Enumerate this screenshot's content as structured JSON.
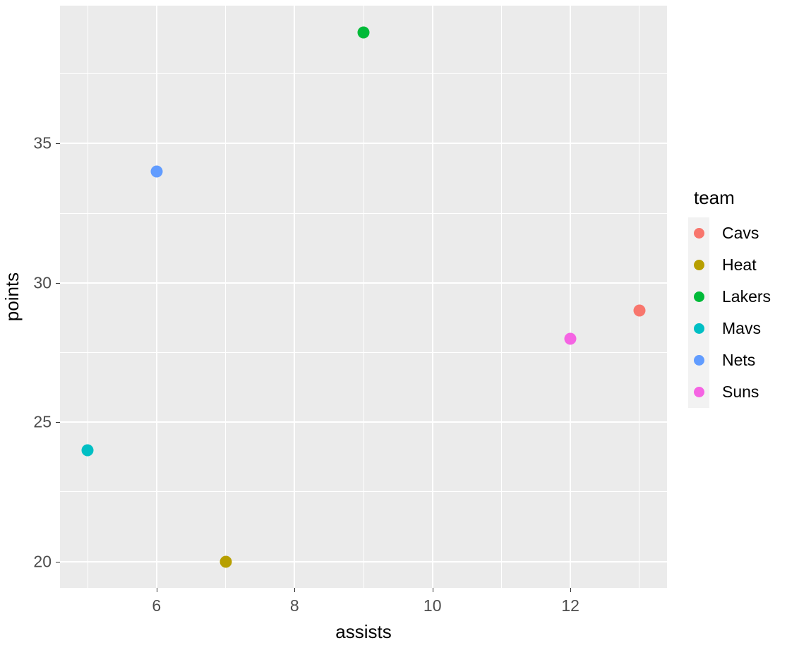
{
  "chart_data": {
    "type": "scatter",
    "title": "",
    "xlabel": "assists",
    "ylabel": "points",
    "xlim": [
      4.6,
      13.4
    ],
    "ylim": [
      19.05,
      39.95
    ],
    "x_ticks": [
      6,
      8,
      10,
      12
    ],
    "y_ticks": [
      20,
      25,
      30,
      35
    ],
    "x_minor_ticks": [
      5,
      7,
      9,
      11,
      13
    ],
    "y_minor_ticks": [
      22.5,
      27.5,
      32.5,
      37.5
    ],
    "grid": true,
    "legend_position": "right",
    "legend_title": "team",
    "point_size": 17,
    "panel_background": "#ebebeb",
    "gridline_color": "#ffffff",
    "axis_text_color": "#4d4d4d",
    "series": [
      {
        "name": "Cavs",
        "color": "#F8766D",
        "x": 13,
        "y": 29
      },
      {
        "name": "Heat",
        "color": "#B79F00",
        "x": 7,
        "y": 20
      },
      {
        "name": "Lakers",
        "color": "#00BA38",
        "x": 9,
        "y": 39
      },
      {
        "name": "Mavs",
        "color": "#00BFC4",
        "x": 5,
        "y": 24
      },
      {
        "name": "Nets",
        "color": "#619CFF",
        "x": 6,
        "y": 34
      },
      {
        "name": "Suns",
        "color": "#F564E3",
        "x": 12,
        "y": 28
      }
    ],
    "points": [
      {
        "team": "Mavs",
        "assists": 5,
        "points": 24
      },
      {
        "team": "Nets",
        "assists": 6,
        "points": 34
      },
      {
        "team": "Heat",
        "assists": 7,
        "points": 20
      },
      {
        "team": "Lakers",
        "assists": 9,
        "points": 39
      },
      {
        "team": "Suns",
        "assists": 12,
        "points": 28
      },
      {
        "team": "Cavs",
        "assists": 13,
        "points": 29
      }
    ]
  },
  "legend": {
    "title": "team",
    "items": [
      {
        "label": "Cavs",
        "color": "#F8766D"
      },
      {
        "label": "Heat",
        "color": "#B79F00"
      },
      {
        "label": "Lakers",
        "color": "#00BA38"
      },
      {
        "label": "Mavs",
        "color": "#00BFC4"
      },
      {
        "label": "Nets",
        "color": "#619CFF"
      },
      {
        "label": "Suns",
        "color": "#F564E3"
      }
    ]
  },
  "axes": {
    "x_title": "assists",
    "y_title": "points",
    "x_tick_labels": [
      "6",
      "8",
      "10",
      "12"
    ],
    "y_tick_labels": [
      "20",
      "25",
      "30",
      "35"
    ]
  }
}
